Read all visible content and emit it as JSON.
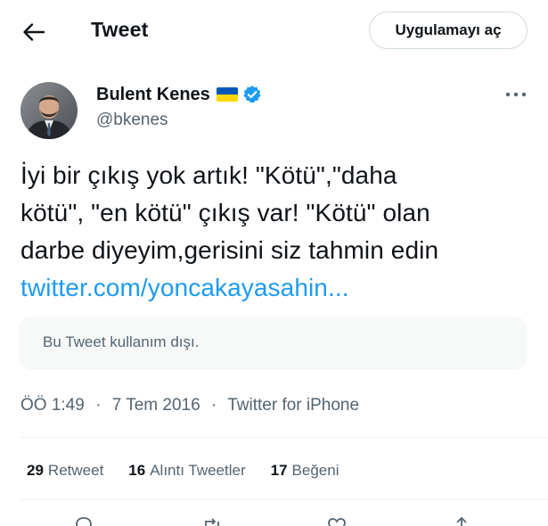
{
  "header": {
    "back_icon": "arrow-left-icon",
    "title": "Tweet",
    "open_app_label": "Uygulamayı aç"
  },
  "author": {
    "name": "Bulent Kenes",
    "handle": "@bkenes",
    "flag_icon": "ukraine-flag-icon",
    "verified_icon": "verified-badge-icon",
    "more_icon": "more-options-icon"
  },
  "tweet": {
    "lines": [
      "İyi bir çıkış yok artık! \"Kötü\",\"daha",
      "kötü\", \"en kötü\" çıkış var! \"Kötü\" olan",
      "darbe diyeyim,gerisini siz tahmin edin"
    ],
    "link": "twitter.com/yoncakayasahin..."
  },
  "quote": {
    "text": "Bu Tweet kullanım dışı."
  },
  "meta": {
    "time": "ÖÖ 1:49",
    "date": "7 Tem 2016",
    "separator": "·",
    "source": "Twitter for iPhone"
  },
  "stats": {
    "retweets": {
      "count": "29",
      "label": "Retweet"
    },
    "quotes": {
      "count": "16",
      "label": "Alıntı Tweetler"
    },
    "likes": {
      "count": "17",
      "label": "Beğeni"
    }
  },
  "colors": {
    "link": "#1d9bf0",
    "secondary_text": "#536471",
    "primary_text": "#0f1419",
    "verified": "#1d9bf0",
    "flag_blue": "#0057b7",
    "flag_yellow": "#ffd700"
  }
}
